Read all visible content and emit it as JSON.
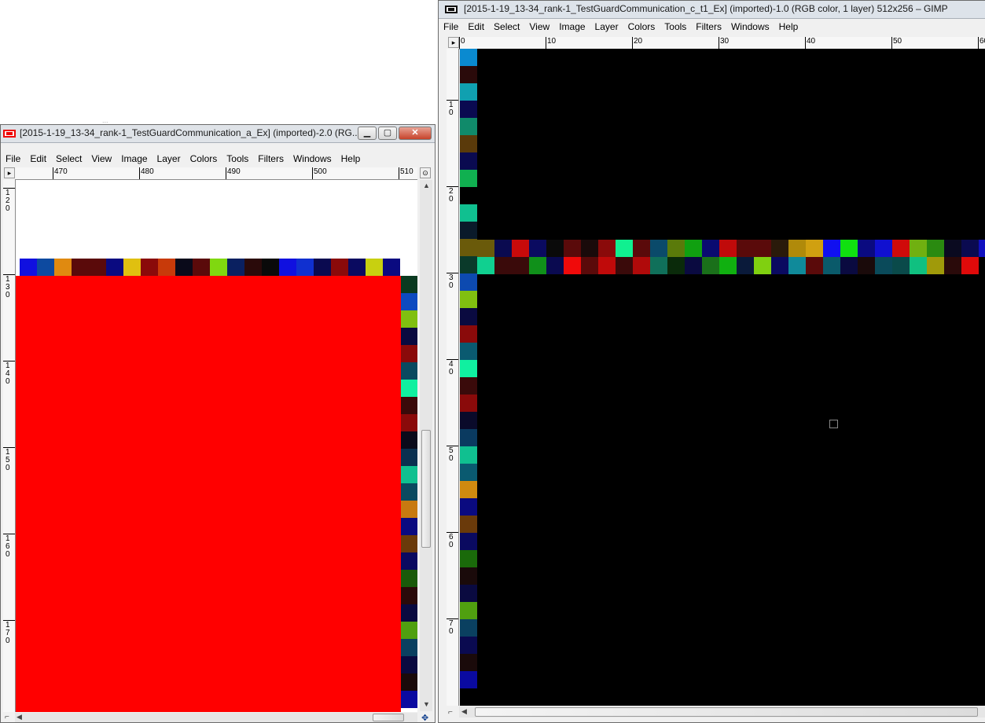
{
  "background_title_fragment": "...",
  "window_a": {
    "title": "[2015-1-19_13-34_rank-1_TestGuardCommunication_a_Ex] (imported)-2.0 (RG...",
    "menu": [
      "File",
      "Edit",
      "Select",
      "View",
      "Image",
      "Layer",
      "Colors",
      "Tools",
      "Filters",
      "Windows",
      "Help"
    ],
    "hruler_ticks": [
      "470",
      "480",
      "490",
      "500",
      "510"
    ],
    "vruler_ticks": [
      "120",
      "130",
      "140",
      "150",
      "160",
      "170"
    ],
    "fill_color": "#ff0000",
    "row_colors": [
      "#1010e0",
      "#0d4aa0",
      "#e08a10",
      "#5a0a0a",
      "#5a0a0a",
      "#0a0a80",
      "#e0c010",
      "#8a0a0a",
      "#c83a0a",
      "#0a0a1a",
      "#5a0a0a",
      "#80d810",
      "#0a2060",
      "#2a0a0a",
      "#0a0a0a",
      "#1010e0",
      "#1030d0",
      "#0a0a50",
      "#8a0a0a",
      "#0a0a60",
      "#c8d010",
      "#0a0a80"
    ],
    "col_colors": [
      "#0a3a20",
      "#0d4ac0",
      "#80c010",
      "#0a0a40",
      "#8a0a0a",
      "#0a4a60",
      "#10f0a0",
      "#3a0a0a",
      "#8a0a0a",
      "#0a0a1a",
      "#0a3050",
      "#10c090",
      "#0a4a60",
      "#c87a10",
      "#0a0a80",
      "#6a3a0a",
      "#0a0a60",
      "#1a5a0a",
      "#2a0a0a",
      "#0a0a40",
      "#50a010",
      "#0a4060",
      "#0a0a40",
      "#1a0a0a",
      "#0a0aa0"
    ]
  },
  "window_c": {
    "title": "[2015-1-19_13-34_rank-1_TestGuardCommunication_c_t1_Ex] (imported)-1.0 (RGB color, 1 layer) 512x256 – GIMP",
    "menu": [
      "File",
      "Edit",
      "Select",
      "View",
      "Image",
      "Layer",
      "Colors",
      "Tools",
      "Filters",
      "Windows",
      "Help"
    ],
    "hruler_ticks": [
      "0",
      "10",
      "20",
      "30",
      "40",
      "50",
      "60"
    ],
    "vruler_ticks": [
      "10",
      "20",
      "30",
      "40",
      "50",
      "60",
      "70"
    ],
    "fill_color": "#000000",
    "col_colors": [
      "#0a8ad0",
      "#2a0a0a",
      "#10a0b0",
      "#0a0a50",
      "#108a6a",
      "#5a3a0a",
      "#0a0a50",
      "#10b050",
      "#000000",
      "#10c090",
      "#0a1a2a",
      "#6a5a0a",
      "#0a3a2a",
      "#0d4ab0",
      "#80c010",
      "#0a0a40",
      "#8a0a0a",
      "#0a5a70",
      "#10f0a0",
      "#3a0a0a",
      "#8a0a0a",
      "#0a0a2a",
      "#0a3a60",
      "#10c090",
      "#0a5a70",
      "#d08a10",
      "#0a0a80",
      "#6a3a0a",
      "#0a0a60",
      "#1a6a0a",
      "#1a0a0a",
      "#0a0a40",
      "#50a010",
      "#0a4060",
      "#0a0a50",
      "#1a0a0a",
      "#0a0aa0"
    ],
    "row1_colors": [
      "#6a5a0a",
      "#0a0a50",
      "#c80a0a",
      "#0a0a60",
      "#0a0a0a",
      "#5a0a0a",
      "#1a0a0a",
      "#8a0a0a",
      "#10f090",
      "#5a0a0a",
      "#0a4a6a",
      "#5a7a0a",
      "#10a010",
      "#0a0a70",
      "#c00a0a",
      "#5a0a0a",
      "#5a0a0a",
      "#2a1a0a",
      "#b08a0a",
      "#d0a010",
      "#1010f0",
      "#10e010",
      "#0a0a80",
      "#1010d0",
      "#d00a0a",
      "#70b010",
      "#2a8a10",
      "#0a0a20",
      "#0a0a50",
      "#1010c0"
    ],
    "row2_colors": [
      "#10d090",
      "#3a0a0a",
      "#3a0a0a",
      "#10901a",
      "#0a0a50",
      "#f00a0a",
      "#5a0a0a",
      "#c00a0a",
      "#3a0a0a",
      "#b00a0a",
      "#10705a",
      "#0a2a0a",
      "#0a0a40",
      "#1a701a",
      "#10b010",
      "#0a1a3a",
      "#80d010",
      "#0a0a60",
      "#108a9a",
      "#5a0a0a",
      "#0a5a6a",
      "#0a0a40",
      "#1a0a0a",
      "#0a4a5a",
      "#0a4a4a",
      "#10c080",
      "#a09a0a",
      "#2a0a0a",
      "#e00a0a"
    ],
    "cursor_label": "□"
  }
}
